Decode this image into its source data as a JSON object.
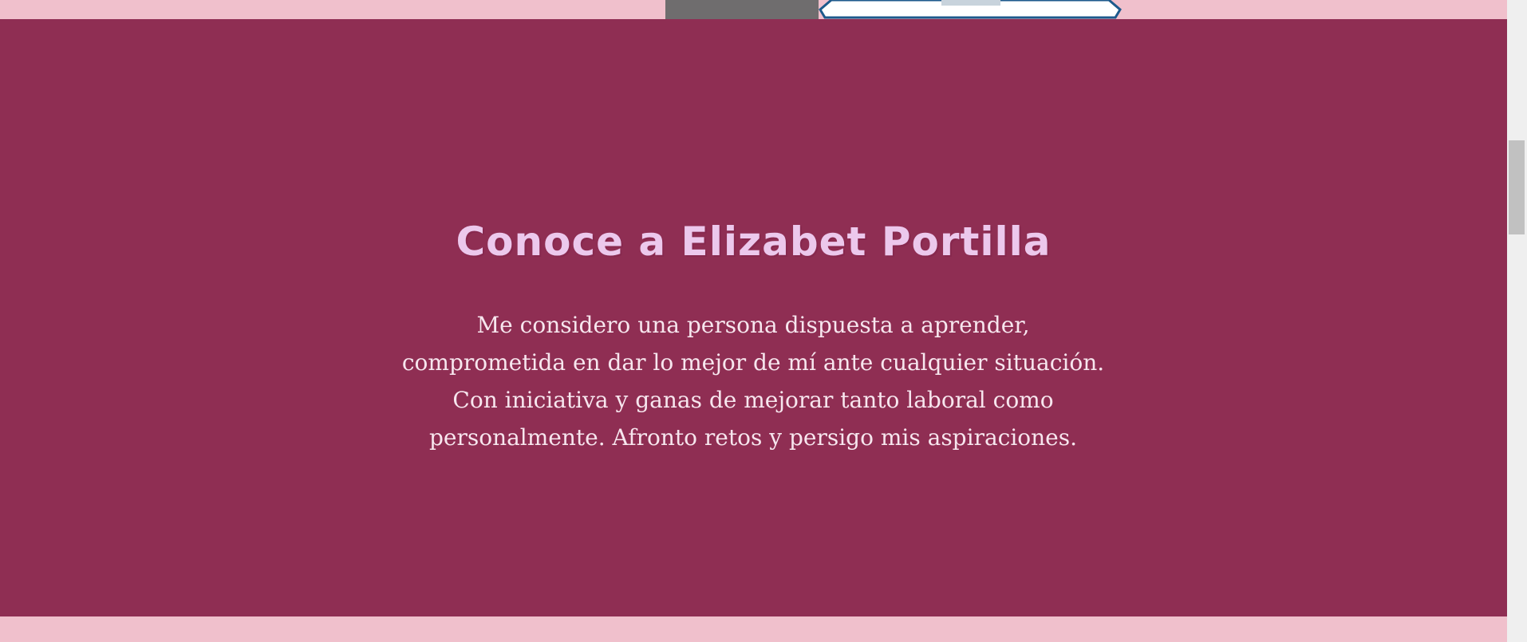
{
  "about": {
    "title": "Conoce a Elizabet Portilla",
    "text": "Me considero una persona dispuesta a aprender, comprometida en dar lo mejor de mí ante cualquier situación. Con iniciativa y ganas de mejorar tanto laboral como personalmente. Afronto retos y persigo mis aspiraciones."
  },
  "colors": {
    "page_background": "#f0c0cc",
    "section_background": "#8f2e53",
    "title_color": "#ecc8ec",
    "text_color": "#f7e6ee"
  },
  "icons": {
    "top_image": "laptop-illustration"
  }
}
